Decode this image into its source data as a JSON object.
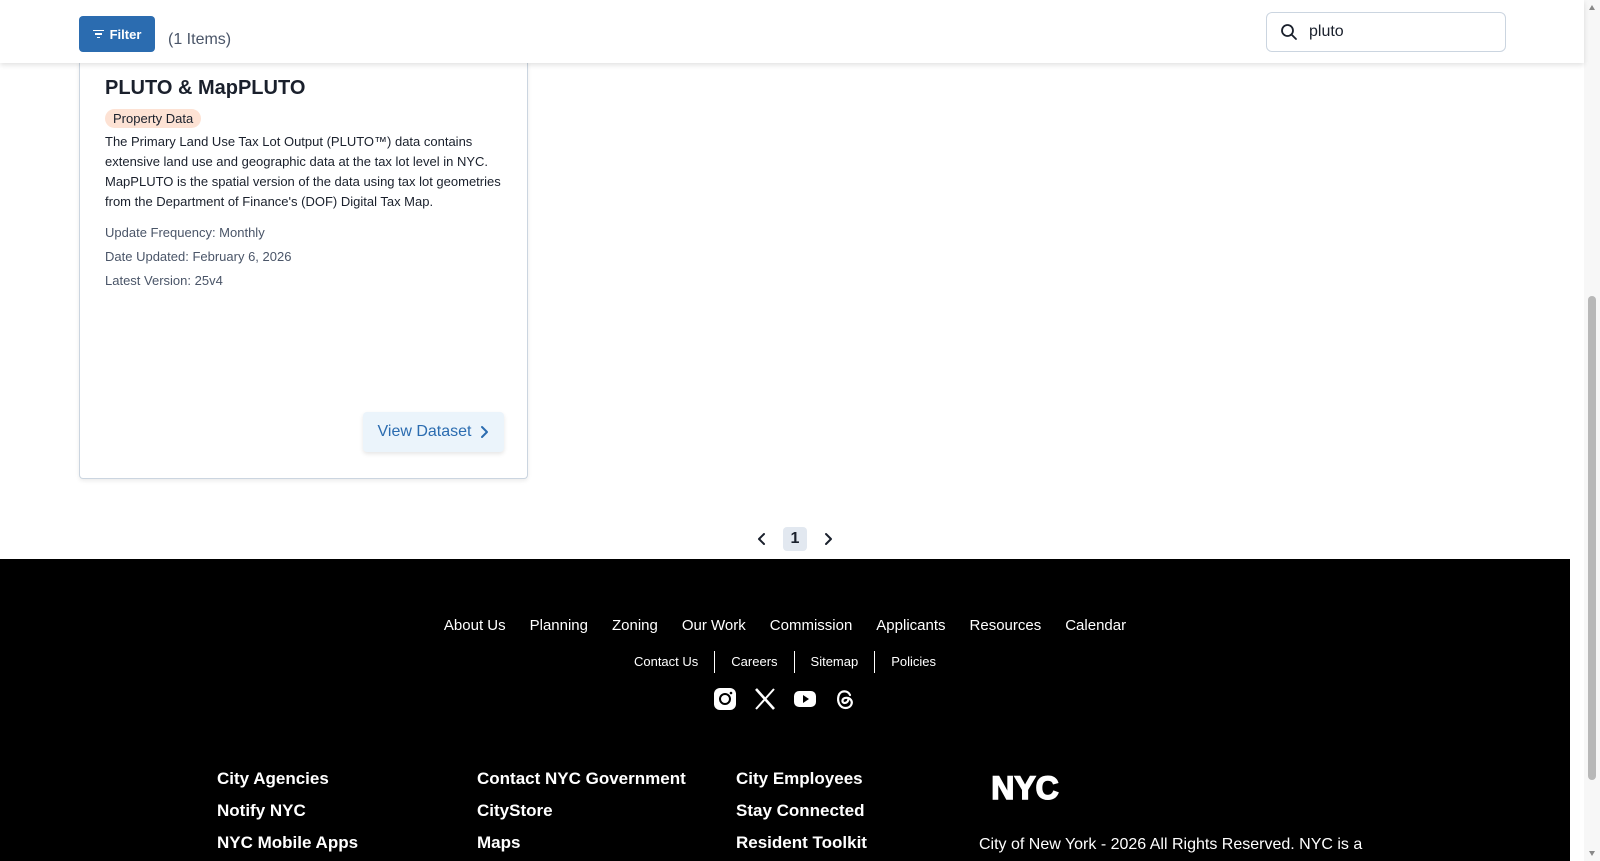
{
  "toolbar": {
    "filter_label": "Filter",
    "items_count": "(1 Items)",
    "search_value": "pluto"
  },
  "card": {
    "title": "PLUTO & MapPLUTO",
    "badge": "Property Data",
    "description": "The Primary Land Use Tax Lot Output (PLUTO™) data contains extensive land use and geographic data at the tax lot level in NYC. MapPLUTO is the spatial version of the data using tax lot geometries from the Department of Finance's (DOF) Digital Tax Map.",
    "update_frequency": "Update Frequency: Monthly",
    "date_updated": "Date Updated: February 6, 2026",
    "latest_version": "Latest Version: 25v4",
    "view_button": "View Dataset"
  },
  "pagination": {
    "current_page": "1"
  },
  "footer": {
    "nav": [
      "About Us",
      "Planning",
      "Zoning",
      "Our Work",
      "Commission",
      "Applicants",
      "Resources",
      "Calendar"
    ],
    "sub": [
      "Contact Us",
      "Careers",
      "Sitemap",
      "Policies"
    ],
    "social": [
      "instagram-icon",
      "x-icon",
      "youtube-icon",
      "threads-icon"
    ],
    "col1": [
      "City Agencies",
      "Notify NYC",
      "NYC Mobile Apps"
    ],
    "col2": [
      "Contact NYC Government",
      "CityStore",
      "Maps"
    ],
    "col3": [
      "City Employees",
      "Stay Connected",
      "Resident Toolkit"
    ],
    "logo_text": "NYC",
    "copyright": "City of New York - 2026 All Rights Reserved. NYC is a"
  },
  "colors": {
    "primary": "#2b6cb0",
    "badge_bg": "#fde2d4",
    "footer_bg": "#000000"
  }
}
